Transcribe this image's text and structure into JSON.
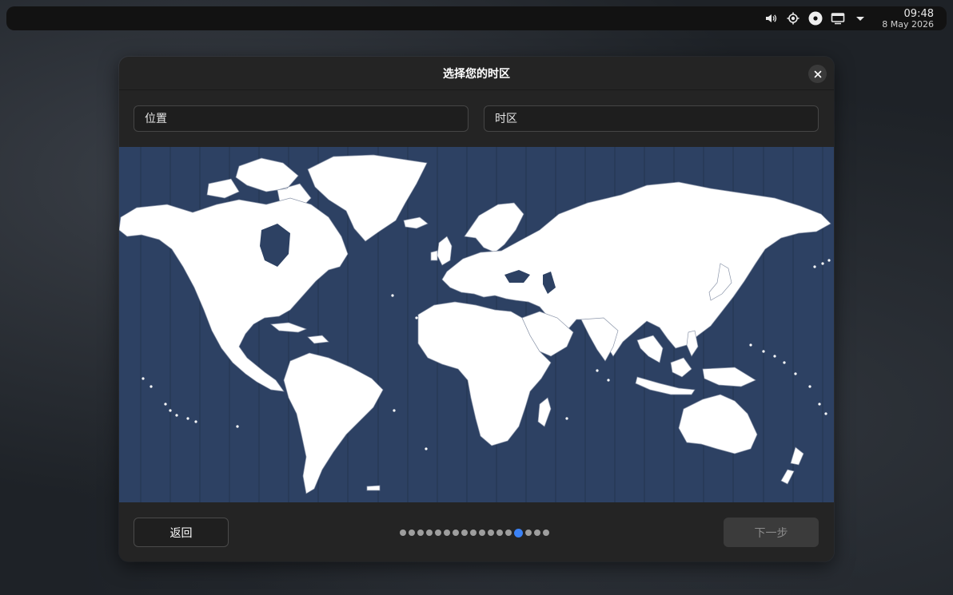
{
  "panel": {
    "clock_time": "09:48",
    "clock_date": "8 May 2026",
    "icons": [
      "volume-icon",
      "brightness-icon",
      "media-disc-icon",
      "display-icon",
      "dropdown-arrow-icon"
    ]
  },
  "dialog": {
    "title": "选择您的时区",
    "close_icon": "close-icon",
    "location_placeholder": "位置",
    "timezone_placeholder": "时区",
    "back_label": "返回",
    "next_label": "下一步",
    "next_enabled": false
  },
  "map": {
    "ocean_color": "#2d4163",
    "land_color": "#ffffff",
    "border_color": "#8c96aa"
  },
  "progress": {
    "total_steps": 17,
    "current_step": 14
  },
  "colors": {
    "accent": "#3b82f6",
    "dialog_bg": "#242424"
  }
}
